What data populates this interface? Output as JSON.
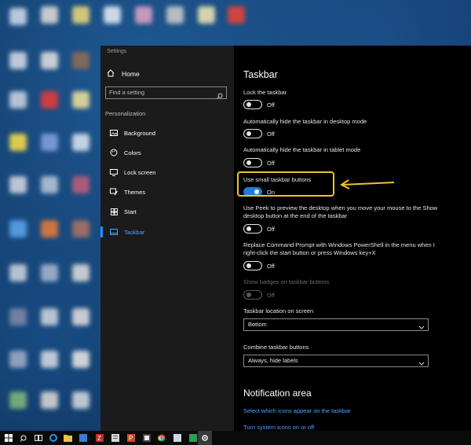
{
  "window": {
    "title": "Settings"
  },
  "sidebar": {
    "home_label": "Home",
    "search_placeholder": "Find a setting",
    "section_label": "Personalization",
    "items": [
      {
        "label": "Background",
        "icon": "picture-icon"
      },
      {
        "label": "Colors",
        "icon": "palette-icon"
      },
      {
        "label": "Lock screen",
        "icon": "monitor-lock-icon"
      },
      {
        "label": "Themes",
        "icon": "brush-icon"
      },
      {
        "label": "Start",
        "icon": "start-grid-icon"
      },
      {
        "label": "Taskbar",
        "icon": "taskbar-icon",
        "active": true
      }
    ]
  },
  "main": {
    "title": "Taskbar",
    "options": [
      {
        "label": "Lock the taskbar",
        "state": "Off",
        "on": false
      },
      {
        "label": "Automatically hide the taskbar in desktop mode",
        "state": "Off",
        "on": false
      },
      {
        "label": "Automatically hide the taskbar in tablet mode",
        "state": "Off",
        "on": false
      },
      {
        "label": "Use small taskbar buttons",
        "state": "On",
        "on": true
      },
      {
        "label": "Use Peek to preview the desktop when you move your mouse to the Show desktop button at the end of the taskbar",
        "state": "Off",
        "on": false
      },
      {
        "label": "Replace Command Prompt with Windows PowerShell in the menu when I right-click the start button or press Windows key+X",
        "state": "Off",
        "on": false
      },
      {
        "label": "Show badges on taskbar buttons",
        "state": "Off",
        "on": false,
        "disabled": true
      }
    ],
    "location": {
      "label": "Taskbar location on screen",
      "value": "Bottom"
    },
    "combine": {
      "label": "Combine taskbar buttons",
      "value": "Always, hide labels"
    },
    "notification": {
      "title": "Notification area",
      "links": [
        "Select which icons appear on the taskbar",
        "Turn system icons on or off"
      ]
    }
  },
  "colors": {
    "accent": "#1e7ad6",
    "highlight": "#f2c12e",
    "link": "#4ea3ff"
  },
  "taskbar_icons": [
    "windows-start-icon",
    "search-icon",
    "task-view-icon",
    "edge-icon",
    "file-explorer-icon",
    "filezilla-icon",
    "word-icon",
    "powerpoint-icon",
    "media-icon",
    "chrome-icon",
    "photos-icon",
    "app-icon",
    "word-doc-icon",
    "settings-gear-icon"
  ]
}
